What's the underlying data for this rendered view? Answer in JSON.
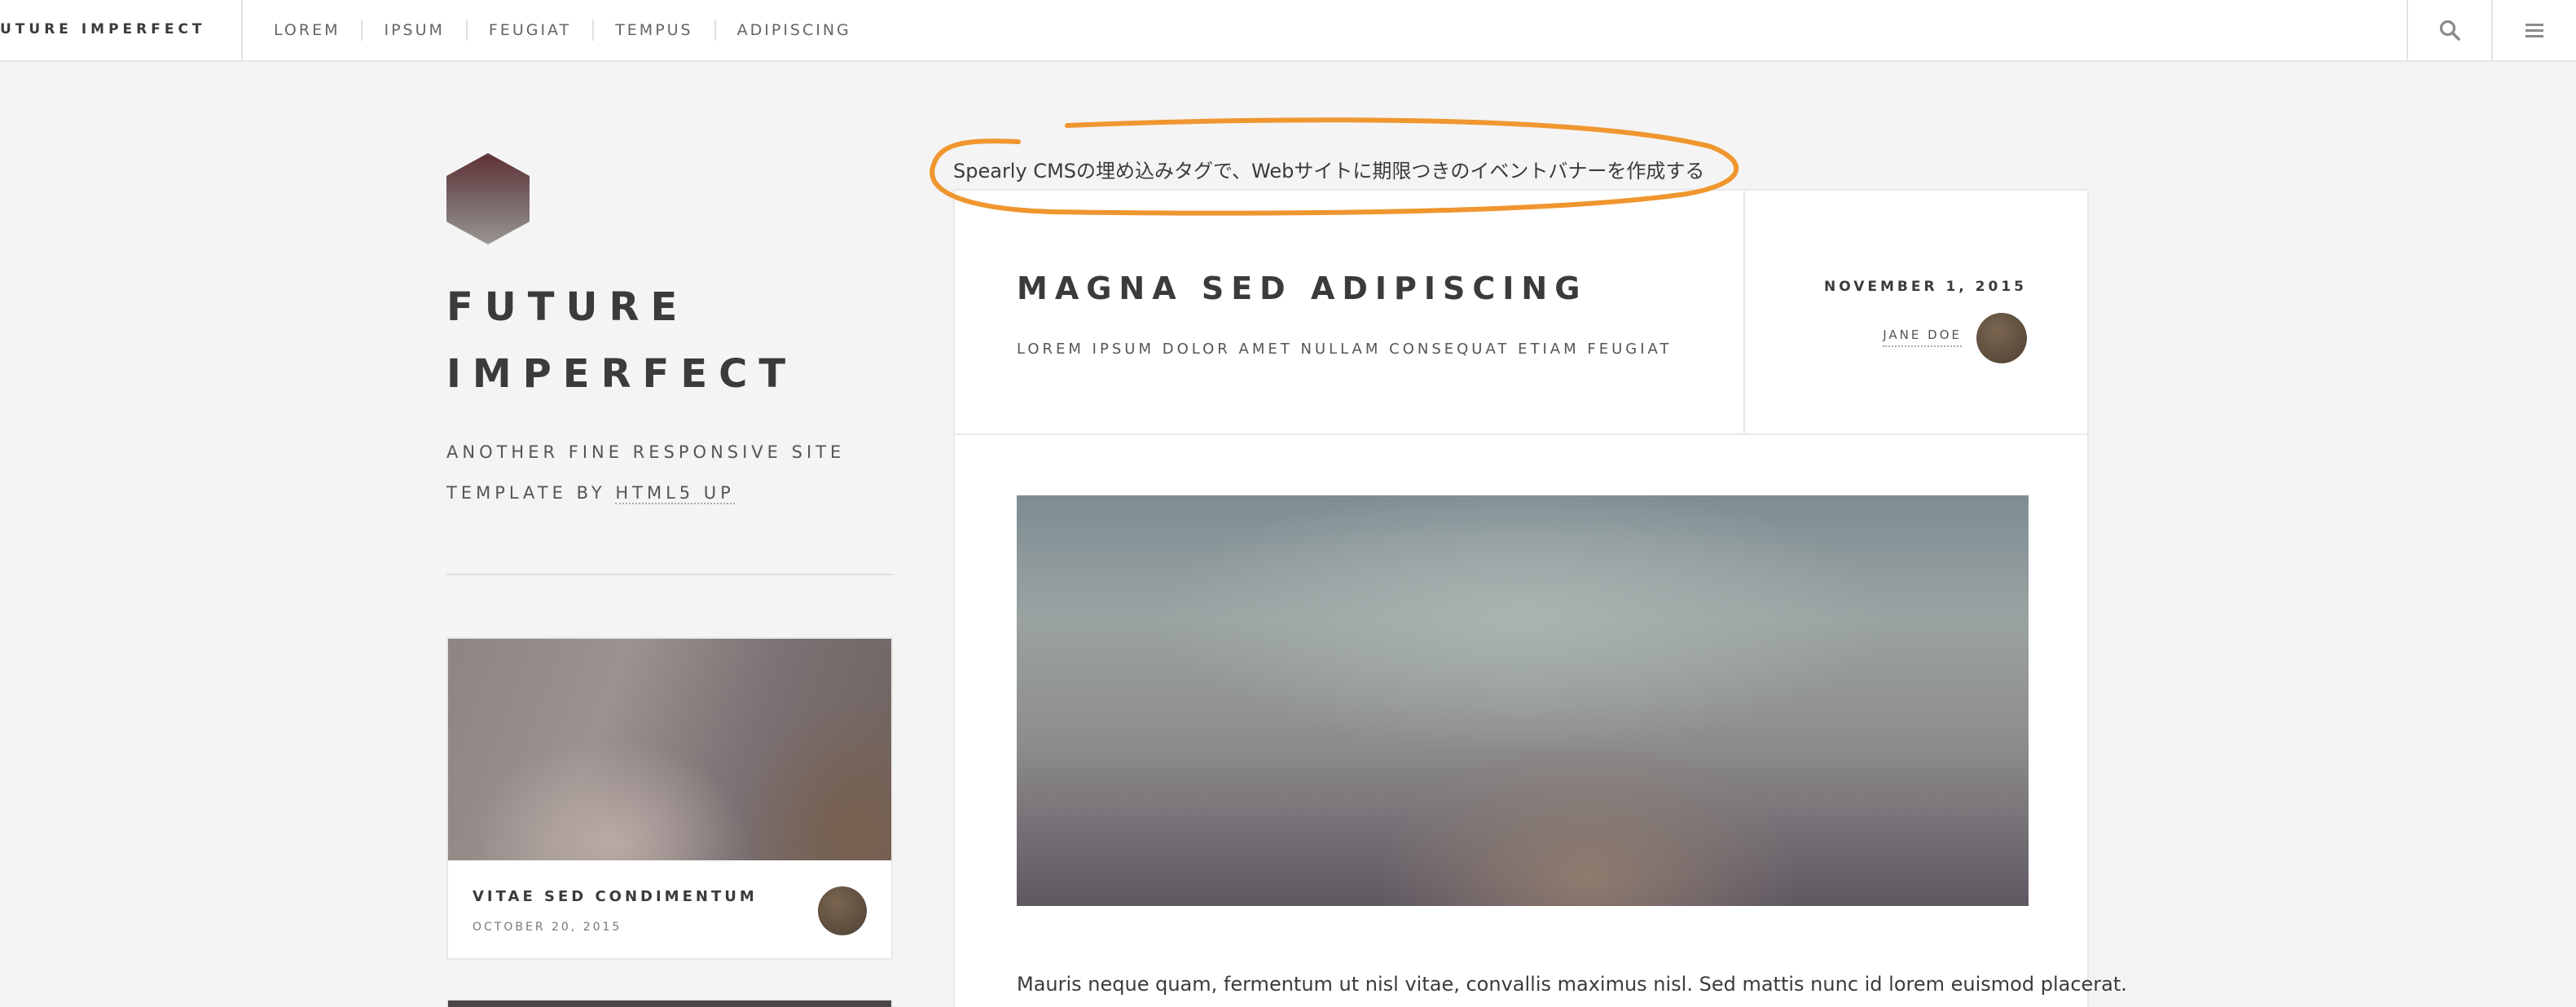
{
  "header": {
    "brand": "UTURE IMPERFECT",
    "nav": [
      "LOREM",
      "IPSUM",
      "FEUGIAT",
      "TEMPUS",
      "ADIPISCING"
    ],
    "search_icon": "search-icon",
    "menu_icon": "hamburger-menu-icon"
  },
  "sidebar": {
    "logo_icon": "hexagon-logo-icon",
    "title_line1": "FUTURE",
    "title_line2": "IMPERFECT",
    "subtitle_line1": "ANOTHER FINE RESPONSIVE SITE",
    "subtitle_prefix": "TEMPLATE BY ",
    "subtitle_link": "HTML5 UP",
    "mini_post": {
      "title": "VITAE SED CONDIMENTUM",
      "date": "OCTOBER 20, 2015"
    }
  },
  "annotation": {
    "text": "Spearly CMSの埋め込みタグで、Webサイトに期限つきのイベントバナーを作成する",
    "color": "#f0962f"
  },
  "article": {
    "title": "MAGNA SED ADIPISCING",
    "subtitle": "LOREM IPSUM DOLOR AMET NULLAM CONSEQUAT ETIAM FEUGIAT",
    "date": "NOVEMBER 1, 2015",
    "author": "JANE DOE",
    "body": "Mauris neque quam, fermentum ut nisl vitae, convallis maximus nisl. Sed mattis nunc id lorem euismod placerat."
  }
}
